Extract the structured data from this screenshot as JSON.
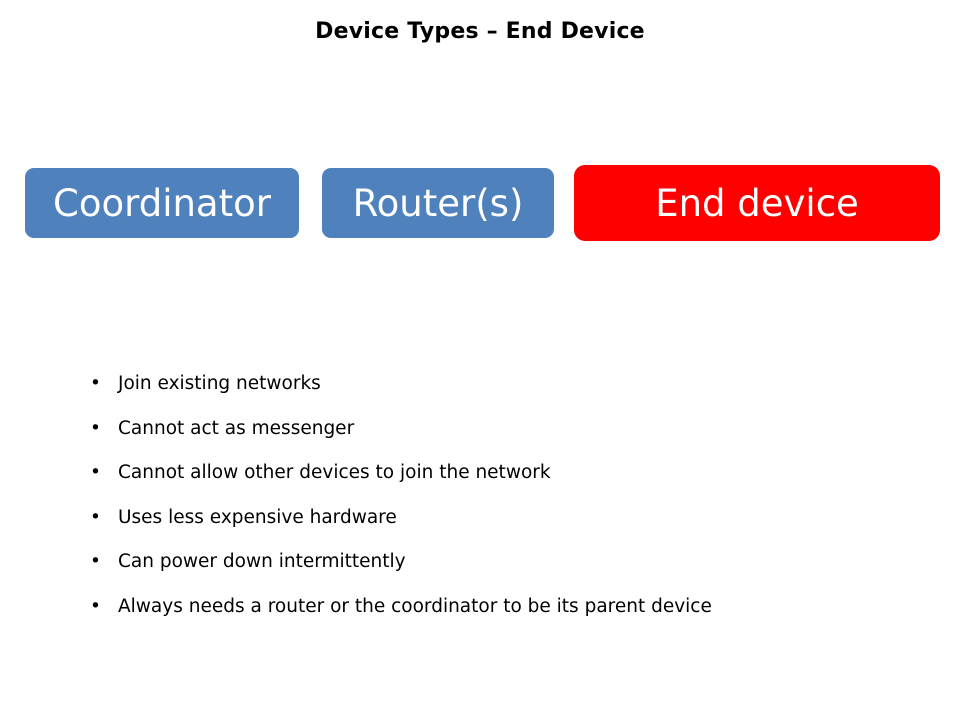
{
  "slide": {
    "title": "Device Types – End Device",
    "background_color": "#ffffff",
    "title_color": "#000000"
  },
  "device_boxes": [
    {
      "label": "Coordinator",
      "fill_color": "#4f81bd",
      "text_color": "#ffffff",
      "state": "inactive"
    },
    {
      "label": "Router(s)",
      "fill_color": "#4f81bd",
      "text_color": "#ffffff",
      "state": "inactive"
    },
    {
      "label": "End device",
      "fill_color": "#ff0000",
      "text_color": "#ffffff",
      "state": "highlighted"
    }
  ],
  "bullets": {
    "marker": "•",
    "items": [
      {
        "text": "Join existing networks"
      },
      {
        "text": "Cannot act as messenger"
      },
      {
        "text": "Cannot allow other devices to join the network"
      },
      {
        "text": "Uses less expensive hardware"
      },
      {
        "text": "Can power down intermittently"
      },
      {
        "text": "Always needs a router or the coordinator to be its parent device"
      }
    ]
  }
}
